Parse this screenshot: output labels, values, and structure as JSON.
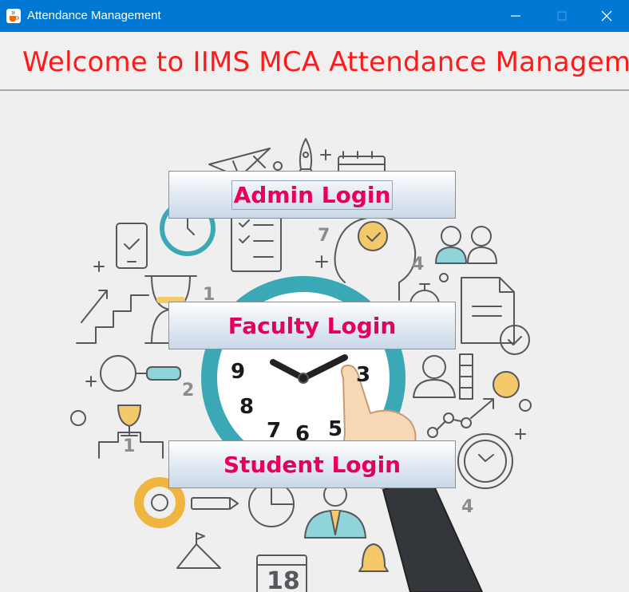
{
  "window": {
    "title": "Attendance Management",
    "app_icon": "java-coffee-icon",
    "controls": [
      "minimize-icon",
      "maximize-icon",
      "close-icon"
    ]
  },
  "header": {
    "welcome_text": "Welcome to IIMS MCA Attendance Management"
  },
  "buttons": {
    "admin": "Admin Login",
    "faculty": "Faculty Login",
    "student": "Student Login"
  },
  "background_art": {
    "clock_numbers": [
      "9",
      "3",
      "8",
      "7",
      "6",
      "5"
    ],
    "calendar_number": "18",
    "decor_numbers": [
      "7",
      "4",
      "1",
      "2",
      "1",
      "4"
    ]
  },
  "colors": {
    "titlebar": "#0078d4",
    "welcome_text": "#ff1a1a",
    "button_text": "#e6005c",
    "clock_teal": "#3aa8b5",
    "accent_yellow": "#f5c86a"
  }
}
